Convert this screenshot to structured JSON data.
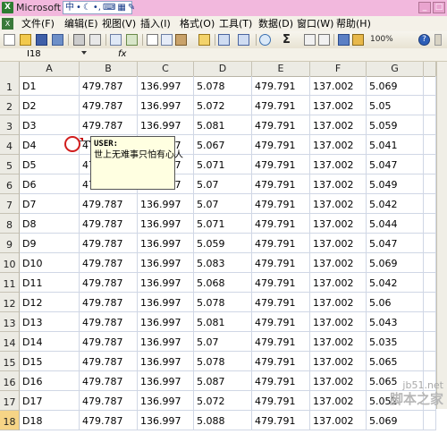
{
  "window": {
    "title": "Microsoft Ex",
    "ime": [
      "中",
      "•",
      "☾",
      "•,",
      "⌨",
      "▦",
      "✎"
    ]
  },
  "menubar": {
    "items": [
      "文件(F)",
      "编辑(E)",
      "视图(V)",
      "插入(I)",
      "格式(O)",
      "工具(T)",
      "数据(D)",
      "窗口(W)",
      "帮助(H)"
    ]
  },
  "toolbar": {
    "zoom": "100%",
    "sigma": "Σ",
    "help": "?"
  },
  "formula_bar": {
    "name_box": "I18",
    "fx": "fx"
  },
  "columns": [
    "A",
    "B",
    "C",
    "D",
    "E",
    "F",
    "G"
  ],
  "rows": [
    {
      "num": "1",
      "cells": [
        "D1",
        "479.787",
        "136.997",
        "5.078",
        "479.791",
        "137.002",
        "5.069"
      ]
    },
    {
      "num": "2",
      "cells": [
        "D2",
        "479.787",
        "136.997",
        "5.072",
        "479.791",
        "137.002",
        "5.05"
      ]
    },
    {
      "num": "3",
      "cells": [
        "D3",
        "479.787",
        "136.997",
        "5.081",
        "479.791",
        "137.002",
        "5.059"
      ]
    },
    {
      "num": "4",
      "cells": [
        "D4",
        "479.787",
        "136.997",
        "5.067",
        "479.791",
        "137.002",
        "5.041"
      ]
    },
    {
      "num": "5",
      "cells": [
        "D5",
        "479.787",
        "136.997",
        "5.071",
        "479.791",
        "137.002",
        "5.047"
      ]
    },
    {
      "num": "6",
      "cells": [
        "D6",
        "479.787",
        "136.997",
        "5.07",
        "479.791",
        "137.002",
        "5.049"
      ]
    },
    {
      "num": "7",
      "cells": [
        "D7",
        "479.787",
        "136.997",
        "5.07",
        "479.791",
        "137.002",
        "5.042"
      ]
    },
    {
      "num": "8",
      "cells": [
        "D8",
        "479.787",
        "136.997",
        "5.071",
        "479.791",
        "137.002",
        "5.044"
      ]
    },
    {
      "num": "9",
      "cells": [
        "D9",
        "479.787",
        "136.997",
        "5.059",
        "479.791",
        "137.002",
        "5.047"
      ]
    },
    {
      "num": "10",
      "cells": [
        "D10",
        "479.787",
        "136.997",
        "5.083",
        "479.791",
        "137.002",
        "5.069"
      ]
    },
    {
      "num": "11",
      "cells": [
        "D11",
        "479.787",
        "136.997",
        "5.068",
        "479.791",
        "137.002",
        "5.042"
      ]
    },
    {
      "num": "12",
      "cells": [
        "D12",
        "479.787",
        "136.997",
        "5.078",
        "479.791",
        "137.002",
        "5.06"
      ]
    },
    {
      "num": "13",
      "cells": [
        "D13",
        "479.787",
        "136.997",
        "5.081",
        "479.791",
        "137.002",
        "5.043"
      ]
    },
    {
      "num": "14",
      "cells": [
        "D14",
        "479.787",
        "136.997",
        "5.07",
        "479.791",
        "137.002",
        "5.035"
      ]
    },
    {
      "num": "15",
      "cells": [
        "D15",
        "479.787",
        "136.997",
        "5.078",
        "479.791",
        "137.002",
        "5.065"
      ]
    },
    {
      "num": "16",
      "cells": [
        "D16",
        "479.787",
        "136.997",
        "5.087",
        "479.791",
        "137.002",
        "5.065"
      ]
    },
    {
      "num": "17",
      "cells": [
        "D17",
        "479.787",
        "136.997",
        "5.072",
        "479.791",
        "137.002",
        "5.052"
      ]
    },
    {
      "num": "18",
      "cells": [
        "D18",
        "479.787",
        "136.997",
        "5.088",
        "479.791",
        "137.002",
        "5.069"
      ]
    }
  ],
  "comment": {
    "author": "USER:",
    "text": "世上无难事只怕有心人"
  },
  "watermark": {
    "domain": "jb51.net",
    "name": "脚本之家"
  }
}
